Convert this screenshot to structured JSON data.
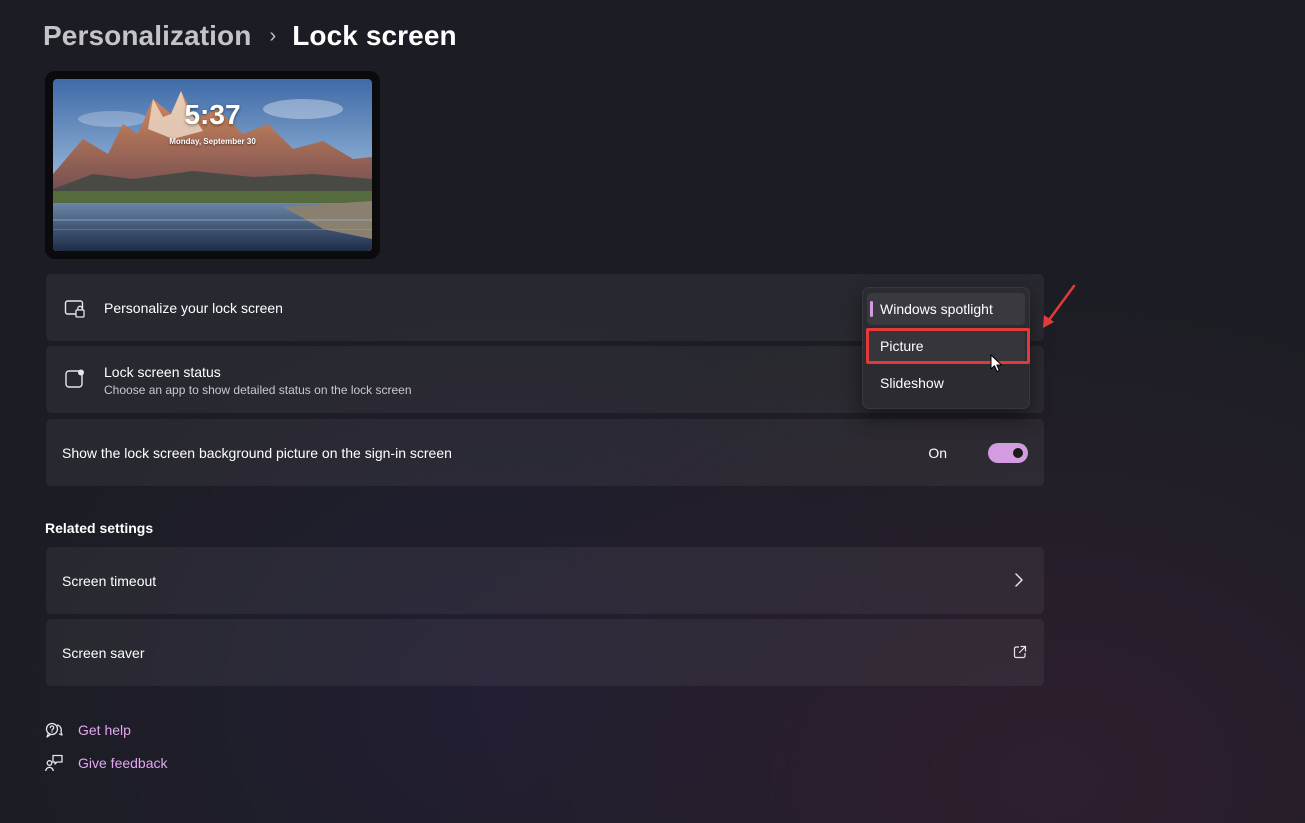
{
  "breadcrumb": {
    "parent": "Personalization",
    "separator": "›",
    "current": "Lock screen"
  },
  "preview": {
    "time": "5:37",
    "date": "Monday, September 30"
  },
  "personalize_card": {
    "icon": "lock-screen-icon",
    "title": "Personalize your lock screen"
  },
  "status_card": {
    "icon": "status-icon",
    "title": "Lock screen status",
    "subtitle": "Choose an app to show detailed status on the lock screen"
  },
  "signin_card": {
    "title": "Show the lock screen background picture on the sign-in screen",
    "toggle_label": "On",
    "toggle_on": true
  },
  "dropdown": {
    "options": [
      "Windows spotlight",
      "Picture",
      "Slideshow"
    ],
    "selected": "Windows spotlight",
    "hovered": "Picture"
  },
  "related": {
    "title": "Related settings",
    "items": [
      {
        "label": "Screen timeout",
        "icon": "chevron-right-icon"
      },
      {
        "label": "Screen saver",
        "icon": "external-link-icon"
      }
    ]
  },
  "help_links": [
    {
      "label": "Get help",
      "icon": "get-help-icon"
    },
    {
      "label": "Give feedback",
      "icon": "give-feedback-icon"
    }
  ],
  "colors": {
    "accent": "#d39be0",
    "link": "#e3a6ef",
    "annotation": "#e23a3a"
  }
}
